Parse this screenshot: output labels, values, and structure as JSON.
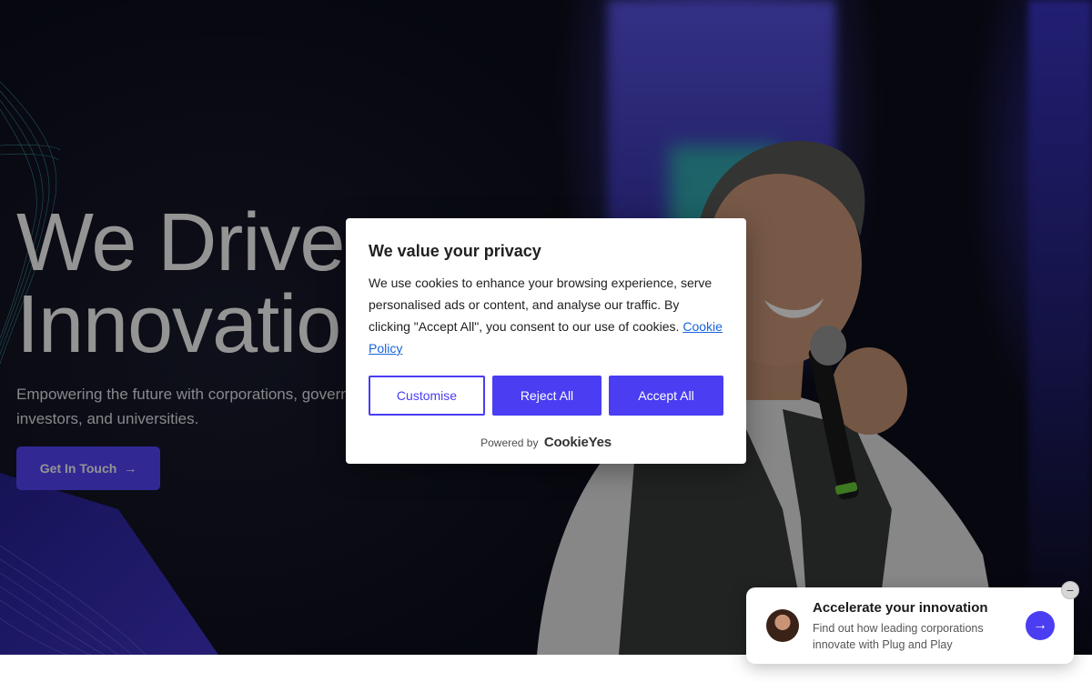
{
  "hero": {
    "title_line1": "We Drive",
    "title_line2": "Innovation",
    "subtitle": "Empowering the future with corporations, governments, startups, investors, and universities.",
    "cta_label": "Get In Touch",
    "cta_arrow": "→"
  },
  "cookie_banner": {
    "title": "We value your privacy",
    "text": "We use cookies to enhance your browsing experience, serve personalised ads or content, and analyse our traffic. By clicking \"Accept All\", you consent to our use of cookies.",
    "policy_link": "Cookie Policy",
    "customise_label": "Customise",
    "reject_label": "Reject All",
    "accept_label": "Accept All",
    "powered_by": "Powered by",
    "brand": "CookieYes"
  },
  "promo": {
    "title": "Accelerate your innovation",
    "text": "Find out how leading corporations innovate with Plug and Play",
    "arrow": "→",
    "close": "−"
  },
  "colors": {
    "accent": "#4a3df2",
    "cta": "#5546ff",
    "link": "#1863dc"
  }
}
